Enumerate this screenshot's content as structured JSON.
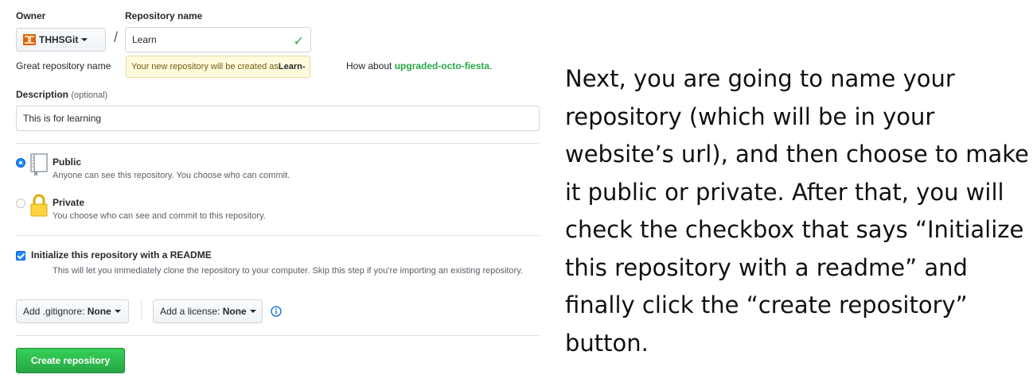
{
  "form": {
    "owner_label": "Owner",
    "owner_value": "THHSGit",
    "repo_name_label": "Repository name",
    "repo_name_value": "Learn",
    "great_name_text": "Great repository name",
    "tooltip_prefix": "Your new repository will be created as ",
    "tooltip_name": "Learn-",
    "suggestion_prefix": "How about ",
    "suggestion_name": "upgraded-octo-fiesta",
    "description_label": "Description",
    "description_optional": "(optional)",
    "description_value": "This is for learning",
    "public_title": "Public",
    "public_desc": "Anyone can see this repository. You choose who can commit.",
    "private_title": "Private",
    "private_desc": "You choose who can see and commit to this repository.",
    "visibility_selected": "public",
    "init_checked": true,
    "init_title": "Initialize this repository with a README",
    "init_desc": "This will let you immediately clone the repository to your computer. Skip this step if you’re importing an existing repository.",
    "gitignore_prefix": "Add .gitignore: ",
    "gitignore_value": "None",
    "license_prefix": "Add a license: ",
    "license_value": "None",
    "create_button": "Create repository"
  },
  "colors": {
    "accent_green": "#28a745",
    "accent_blue": "#2188ff",
    "tooltip_bg": "#fffbdd"
  },
  "icons": {
    "owner_avatar": "owner-avatar-icon",
    "check": "check-icon",
    "public": "repo-book-icon",
    "private": "lock-icon",
    "info": "info-icon"
  },
  "instructions": {
    "text": "Next, you are going to name your repository (which will be in your website’s url), and then choose to make it public or private.  After that, you will check the checkbox that says “Initialize this repository with a readme” and finally click the “create repository” button."
  }
}
